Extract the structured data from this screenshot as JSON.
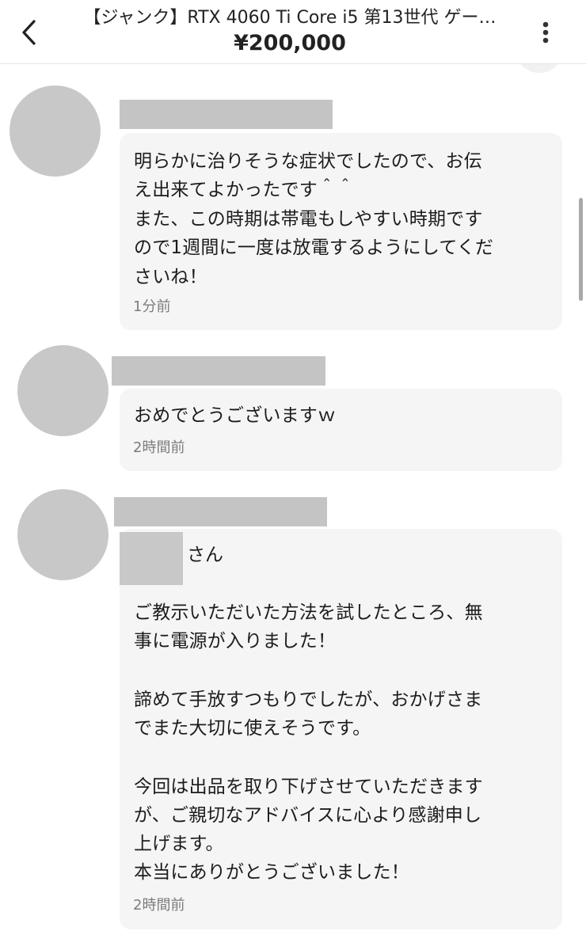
{
  "header": {
    "title": "【ジャンク】RTX 4060 Ti Core i5 第13世代 ゲー…",
    "price": "¥200,000",
    "back_icon": "chevron-left-icon",
    "more_icon": "more-vertical-icon"
  },
  "comments": [
    {
      "lines": [
        "明らかに治りそうな症状でしたので、お伝",
        "え出来てよかったです＾＾",
        "また、この時期は帯電もしやすい時期です",
        "ので1週間に一度は放電するようにしてくだ",
        "さいね！"
      ],
      "time": "1分前"
    },
    {
      "lines": [
        "おめでとうございますｗ"
      ],
      "time": "2時間前"
    },
    {
      "mention_suffix": "さん",
      "lines": [
        "ご教示いただいた方法を試したところ、無",
        "事に電源が入りました！",
        "",
        "諦めて手放すつもりでしたが、おかげさま",
        "でまた大切に使えそうです。",
        "",
        "今回は出品を取り下げさせていただきます",
        "が、ご親切なアドバイスに心より感謝申し",
        "上げます。",
        "本当にありがとうございました！"
      ],
      "time": "2時間前"
    }
  ]
}
